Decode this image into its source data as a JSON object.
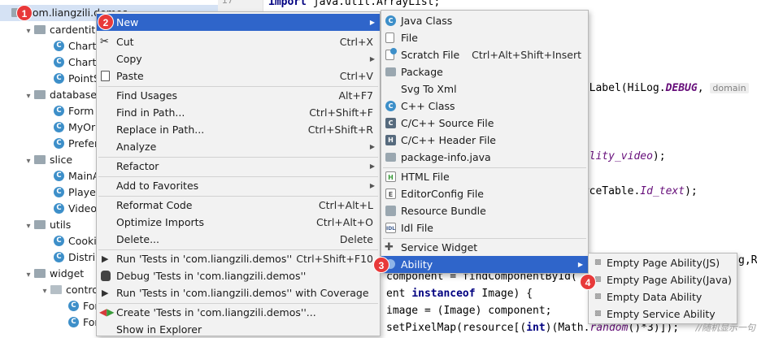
{
  "tree": {
    "root_label": "com.liangzili.demos",
    "items": [
      {
        "label": "cardentit",
        "type": "folder",
        "arrow": "▾"
      },
      {
        "label": "ChartI",
        "type": "class"
      },
      {
        "label": "ChartI",
        "type": "class"
      },
      {
        "label": "PointS",
        "type": "class"
      },
      {
        "label": "database",
        "type": "folder",
        "arrow": "▾"
      },
      {
        "label": "Form",
        "type": "class"
      },
      {
        "label": "MyOr",
        "type": "class"
      },
      {
        "label": "Prefer",
        "type": "class"
      },
      {
        "label": "slice",
        "type": "folder",
        "arrow": "▾"
      },
      {
        "label": "MainA",
        "type": "class"
      },
      {
        "label": "Player",
        "type": "class"
      },
      {
        "label": "Video",
        "type": "class"
      },
      {
        "label": "utils",
        "type": "folder",
        "arrow": "▾"
      },
      {
        "label": "Cooki",
        "type": "class"
      },
      {
        "label": "Distrib",
        "type": "class"
      },
      {
        "label": "widget",
        "type": "folder",
        "arrow": "▾"
      },
      {
        "label": "contro",
        "type": "folder",
        "arrow": "▾"
      },
      {
        "label": "For",
        "type": "class"
      },
      {
        "label": "For",
        "type": "class"
      }
    ]
  },
  "gutter": {
    "line_number": "17"
  },
  "editor": {
    "line1": {
      "kw": "import",
      "rest": " java.util.ArrayList;"
    },
    "line2": {
      "pre": "ogLabel(HiLog.",
      "const": "DEBUG",
      "post": ",",
      "hint": "domain"
    },
    "line3": {
      "ital": "bility_video",
      "post": ");"
    },
    "line4": {
      "pre": "urceTable.",
      "ital": "Id_text",
      "post": ");"
    },
    "line5": {
      "pre": "g,R"
    },
    "line6": {
      "text": "component = findComponentById("
    },
    "line7": {
      "pre": "ent ",
      "kw": "instanceof",
      "post": " Image) {"
    },
    "line8": {
      "text": "image = (Image) component;"
    },
    "line9": {
      "pre": "setPixelMap(resource[(",
      "kw": "int",
      "mid": ")(Math.",
      "ital": "random",
      "post": "()*3)]);"
    }
  },
  "main_menu": {
    "items": [
      {
        "label": "New",
        "icon": "",
        "submenu": true
      },
      {
        "label": "Cut",
        "shortcut": "Ctrl+X",
        "icon": "scissors-icon"
      },
      {
        "label": "Copy",
        "submenu": true
      },
      {
        "label": "Paste",
        "shortcut": "Ctrl+V",
        "icon": "clipboard-icon"
      },
      {
        "label": "Find Usages",
        "shortcut": "Alt+F7"
      },
      {
        "label": "Find in Path...",
        "shortcut": "Ctrl+Shift+F"
      },
      {
        "label": "Replace in Path...",
        "shortcut": "Ctrl+Shift+R"
      },
      {
        "label": "Analyze",
        "submenu": true
      },
      {
        "label": "Refactor",
        "submenu": true
      },
      {
        "label": "Add to Favorites",
        "submenu": true
      },
      {
        "label": "Reformat Code",
        "shortcut": "Ctrl+Alt+L"
      },
      {
        "label": "Optimize Imports",
        "shortcut": "Ctrl+Alt+O"
      },
      {
        "label": "Delete...",
        "shortcut": "Delete"
      },
      {
        "label": "Run 'Tests in 'com.liangzili.demos''",
        "shortcut": "Ctrl+Shift+F10",
        "icon": "run-icon"
      },
      {
        "label": "Debug 'Tests in 'com.liangzili.demos''",
        "icon": "debug-icon"
      },
      {
        "label": "Run 'Tests in 'com.liangzili.demos'' with Coverage",
        "icon": "coverage-icon"
      },
      {
        "label": "Create 'Tests in 'com.liangzili.demos''...",
        "icon": "create-test-icon"
      },
      {
        "label": "Show in Explorer"
      }
    ]
  },
  "new_menu": {
    "items": [
      {
        "label": "Java Class",
        "icon": "java-class-icon"
      },
      {
        "label": "File",
        "icon": "file-icon"
      },
      {
        "label": "Scratch File",
        "shortcut": "Ctrl+Alt+Shift+Insert",
        "icon": "scratch-file-icon"
      },
      {
        "label": "Package",
        "icon": "package-icon"
      },
      {
        "label": "Svg To Xml",
        "icon": ""
      },
      {
        "label": "C++ Class",
        "icon": "cpp-class-icon"
      },
      {
        "label": "C/C++ Source File",
        "icon": "c-source-icon"
      },
      {
        "label": "C/C++ Header File",
        "icon": "c-header-icon"
      },
      {
        "label": "package-info.java",
        "icon": "package-info-icon"
      },
      {
        "label": "HTML File",
        "icon": "html-file-icon"
      },
      {
        "label": "EditorConfig File",
        "icon": "editorconfig-icon"
      },
      {
        "label": "Resource Bundle",
        "icon": "resource-bundle-icon"
      },
      {
        "label": "Idl File",
        "icon": "idl-file-icon"
      },
      {
        "label": "Service Widget",
        "icon": "service-widget-icon"
      },
      {
        "label": "Ability",
        "icon": "ability-icon",
        "submenu": true
      }
    ]
  },
  "ability_menu": {
    "items": [
      {
        "label": "Empty Page Ability(JS)"
      },
      {
        "label": "Empty Page Ability(Java)"
      },
      {
        "label": "Empty Data Ability"
      },
      {
        "label": "Empty Service Ability"
      }
    ]
  },
  "badges": {
    "b1": "1",
    "b2": "2",
    "b3": "3",
    "b4": "4"
  },
  "watermark": "//随机显示一句",
  "colors": {
    "highlight": "#2f65ca",
    "badge": "#e8393a",
    "class_icon": "#3d8fc9",
    "keyword": "#000080"
  }
}
